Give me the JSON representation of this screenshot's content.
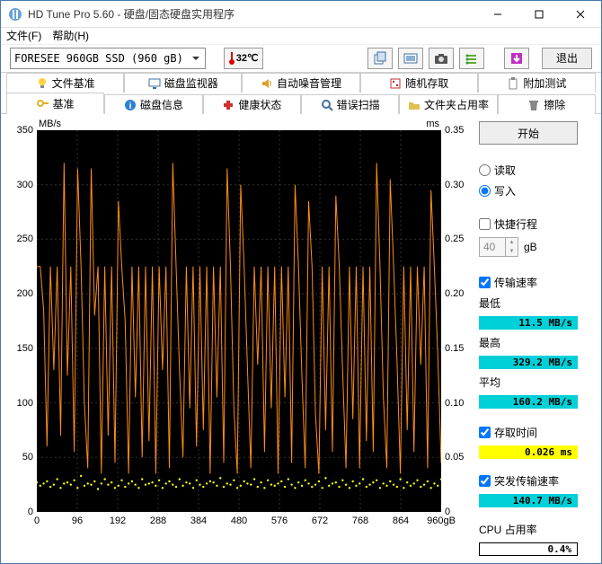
{
  "window": {
    "title": "HD Tune Pro 5.60 - 硬盘/固态硬盘实用程序"
  },
  "menu": {
    "file": "文件",
    "file_key": "(F)",
    "help": "帮助",
    "help_key": "(H)"
  },
  "drive": {
    "selected": "FORESEE 960GB SSD (960 gB)"
  },
  "temperature": {
    "value": "32℃"
  },
  "toolbar": {
    "exit": "退出"
  },
  "tabs_row1": [
    {
      "label": "文件基准"
    },
    {
      "label": "磁盘监视器"
    },
    {
      "label": "自动噪音管理"
    },
    {
      "label": "随机存取"
    },
    {
      "label": "附加测试"
    }
  ],
  "tabs_row2": [
    {
      "label": "基准"
    },
    {
      "label": "磁盘信息"
    },
    {
      "label": "健康状态"
    },
    {
      "label": "错误扫描"
    },
    {
      "label": "文件夹占用率"
    },
    {
      "label": "擦除"
    }
  ],
  "chart": {
    "y_left_unit": "MB/s",
    "y_right_unit": "ms",
    "y_left": [
      "350",
      "300",
      "250",
      "200",
      "150",
      "100",
      "50",
      "0"
    ],
    "y_right": [
      "0.35",
      "0.30",
      "0.25",
      "0.20",
      "0.15",
      "0.10",
      "0.05",
      "0"
    ],
    "x": [
      "0",
      "96",
      "192",
      "288",
      "384",
      "480",
      "576",
      "672",
      "768",
      "864",
      "960gB"
    ]
  },
  "panel": {
    "start": "开始",
    "read": "读取",
    "write": "写入",
    "short_stroke": "快捷行程",
    "stroke_value": "40",
    "stroke_unit": "gB",
    "transfer_rate": "传输速率",
    "min_label": "最低",
    "min_value": "11.5 MB/s",
    "max_label": "最高",
    "max_value": "329.2 MB/s",
    "avg_label": "平均",
    "avg_value": "160.2 MB/s",
    "access_time": "存取时间",
    "access_value": "0.026 ms",
    "burst_rate": "突发传输速率",
    "burst_value": "140.7 MB/s",
    "cpu_label": "CPU 占用率",
    "cpu_value": "0.4%"
  },
  "selected": {
    "mode": "write",
    "short_stroke": false,
    "transfer": true,
    "access": true,
    "burst": true
  },
  "chart_data": {
    "type": "line",
    "title": "",
    "xlabel": "gB",
    "ylabel_left": "MB/s",
    "ylabel_right": "ms",
    "x_range": [
      0,
      960
    ],
    "y_left_range": [
      0,
      350
    ],
    "y_right_range": [
      0,
      0.35
    ],
    "series": [
      {
        "name": "写入传输速率 (MB/s)",
        "axis": "left",
        "color": "#ff8c1a",
        "summary": {
          "min": 11.5,
          "max": 329.2,
          "avg": 160.2
        },
        "values_sampled_every_8gB": [
          225,
          225,
          185,
          60,
          225,
          130,
          225,
          70,
          320,
          125,
          225,
          55,
          315,
          225,
          100,
          40,
          315,
          180,
          225,
          35,
          225,
          70,
          225,
          45,
          285,
          225,
          175,
          35,
          225,
          105,
          225,
          50,
          225,
          65,
          225,
          35,
          225,
          130,
          225,
          40,
          320,
          225,
          130,
          50,
          225,
          95,
          225,
          60,
          225,
          75,
          225,
          35,
          225,
          105,
          225,
          45,
          315,
          225,
          95,
          35,
          300,
          225,
          130,
          40,
          225,
          135,
          225,
          55,
          225,
          95,
          225,
          35,
          225,
          105,
          225,
          45,
          300,
          225,
          125,
          40,
          285,
          225,
          90,
          35,
          225,
          75,
          225,
          55,
          290,
          225,
          130,
          40,
          225,
          85,
          225,
          40,
          225,
          65,
          225,
          55,
          320,
          225,
          105,
          40,
          305,
          225,
          140,
          35,
          225,
          75,
          225,
          55,
          225,
          135,
          225,
          40,
          295,
          225,
          145,
          45
        ]
      },
      {
        "name": "存取时间 (ms)",
        "axis": "right",
        "color": "#ffff00",
        "summary": {
          "avg": 0.026
        },
        "values_sampled_every_8gB": [
          0.027,
          0.024,
          0.026,
          0.028,
          0.023,
          0.025,
          0.03,
          0.022,
          0.026,
          0.027,
          0.025,
          0.029,
          0.022,
          0.033,
          0.024,
          0.026,
          0.025,
          0.028,
          0.021,
          0.026,
          0.03,
          0.025,
          0.027,
          0.022,
          0.024,
          0.029,
          0.023,
          0.026,
          0.028,
          0.025,
          0.022,
          0.03,
          0.025,
          0.026,
          0.027,
          0.024,
          0.029,
          0.022,
          0.026,
          0.028,
          0.025,
          0.023,
          0.03,
          0.024,
          0.027,
          0.026,
          0.022,
          0.029,
          0.025,
          0.023,
          0.026,
          0.028,
          0.027,
          0.024,
          0.031,
          0.023,
          0.026,
          0.025,
          0.029,
          0.022,
          0.024,
          0.028,
          0.026,
          0.025,
          0.03,
          0.023,
          0.027,
          0.022,
          0.029,
          0.025,
          0.024,
          0.026,
          0.028,
          0.023,
          0.03,
          0.025,
          0.022,
          0.027,
          0.024,
          0.029,
          0.026,
          0.023,
          0.025,
          0.028,
          0.022,
          0.031,
          0.024,
          0.026,
          0.027,
          0.023,
          0.029,
          0.025,
          0.022,
          0.028,
          0.024,
          0.026,
          0.03,
          0.023,
          0.025,
          0.027,
          0.029,
          0.022,
          0.026,
          0.024,
          0.028,
          0.025,
          0.023,
          0.03,
          0.022,
          0.027,
          0.024,
          0.026,
          0.029,
          0.023,
          0.025,
          0.028,
          0.022,
          0.026,
          0.024,
          0.03
        ]
      }
    ]
  }
}
